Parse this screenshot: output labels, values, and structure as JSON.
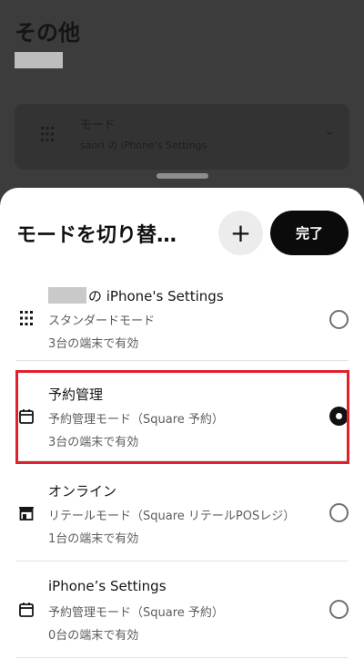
{
  "background": {
    "title": "その他",
    "card": {
      "title": "モード",
      "subtitle": "saori の iPhone's Settings"
    }
  },
  "sheet": {
    "title": "モードを切り替…",
    "add_label": "+",
    "done_label": "完了",
    "items": [
      {
        "title_suffix": "の iPhone's Settings",
        "subtitle": "スタンダードモード",
        "devices": "3台の端末で有効",
        "icon": "keypad-icon",
        "selected": false
      },
      {
        "title": "予約管理",
        "subtitle": "予約管理モード（Square 予約）",
        "devices": "3台の端末で有効",
        "icon": "calendar-icon",
        "selected": true
      },
      {
        "title": "オンライン",
        "subtitle": "リテールモード（Square リテールPOSレジ）",
        "devices": "1台の端末で有効",
        "icon": "store-icon",
        "selected": false
      },
      {
        "title": "iPhone’s Settings",
        "subtitle": "予約管理モード（Square 予約）",
        "devices": "0台の端末で有効",
        "icon": "calendar-icon",
        "selected": false
      }
    ]
  },
  "colors": {
    "highlight": "#e0212d",
    "primary_button": "#0b0b0b"
  }
}
